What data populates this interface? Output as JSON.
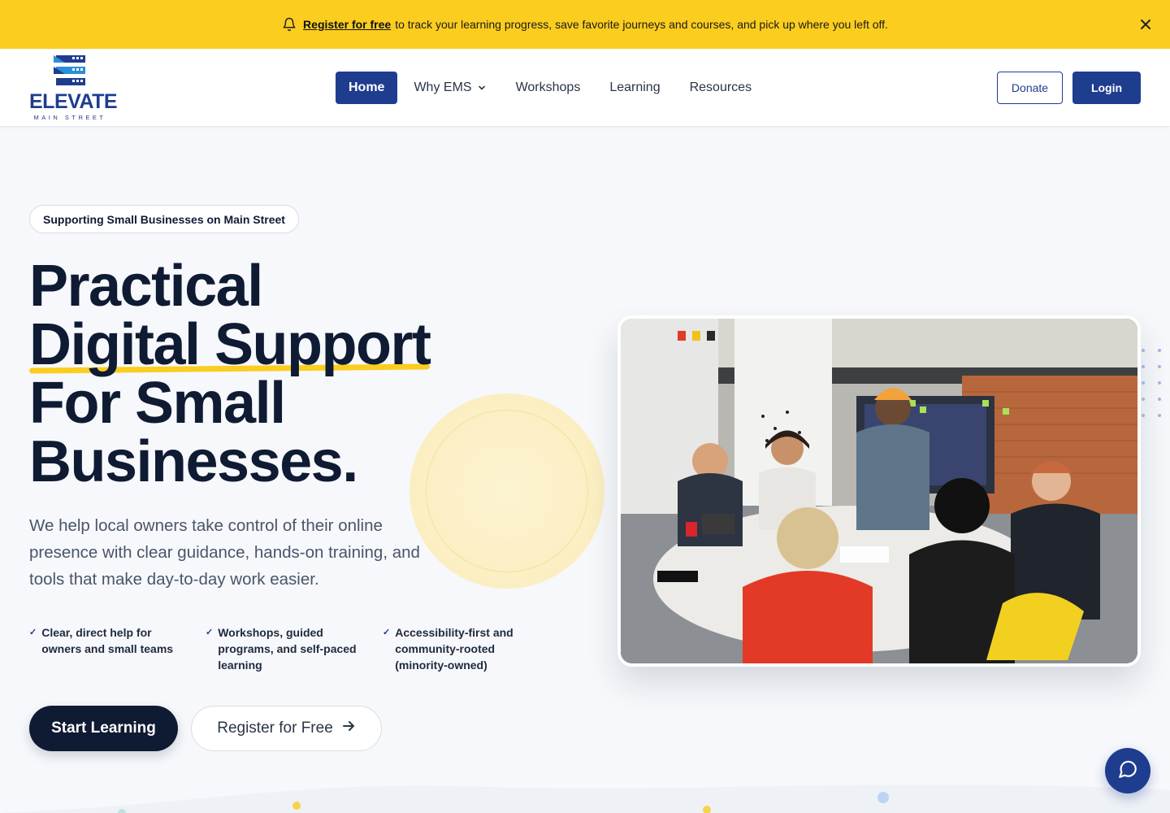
{
  "announcement": {
    "link": "Register for free",
    "text": "to track your learning progress, save favorite journeys and courses, and pick up where you left off."
  },
  "brand": {
    "name": "ELEVATE",
    "tagline": "MAIN STREET",
    "color": "#1f3d8f",
    "accent": "#fbcd1e"
  },
  "nav": {
    "home": "Home",
    "why": "Why EMS",
    "workshops": "Workshops",
    "learning": "Learning",
    "resources": "Resources"
  },
  "header_actions": {
    "donate": "Donate",
    "login": "Login"
  },
  "hero": {
    "pill": "Supporting Small Businesses on Main Street",
    "headline": [
      "Practical",
      "Digital Support",
      "For Small",
      "Businesses."
    ],
    "lede": "We help local owners take control of their online presence with clear guidance, hands-on training, and tools that make day-to-day work easier.",
    "features": [
      "Clear, direct help for owners and small teams",
      "Workshops, guided programs, and self-paced learning",
      "Accessibility-first and community-rooted (minority-owned)"
    ],
    "cta_primary": "Start Learning",
    "cta_secondary": "Register for Free"
  },
  "icons": [
    "bell-icon",
    "close-icon",
    "chevron-down-icon",
    "check-icon",
    "arrow-right-icon",
    "chat-icon"
  ]
}
